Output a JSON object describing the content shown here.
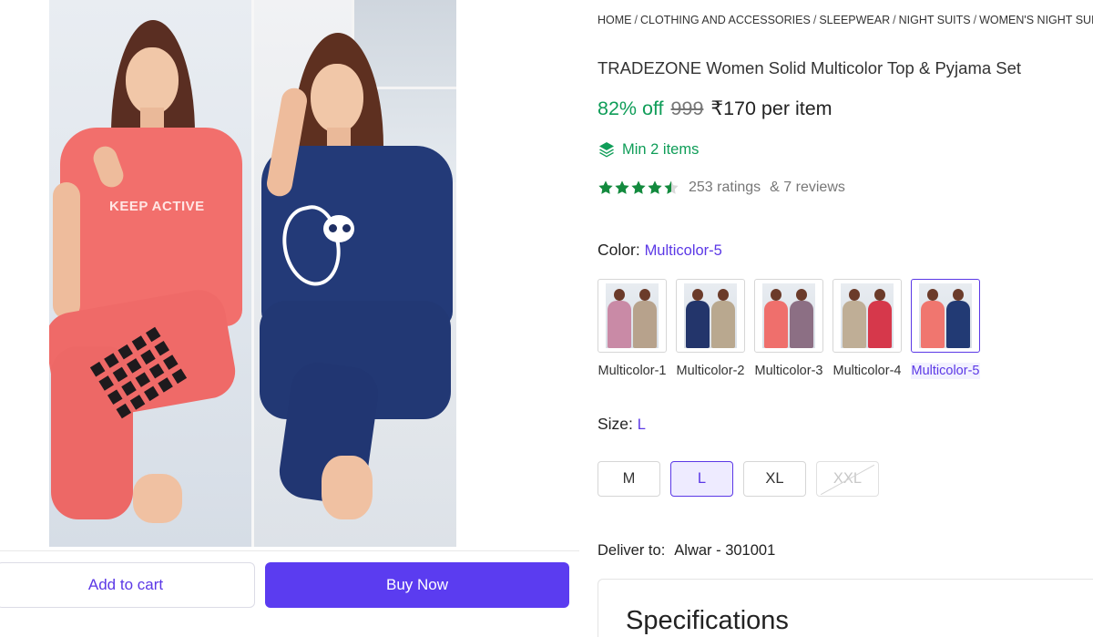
{
  "breadcrumb": [
    "HOME",
    "CLOTHING AND ACCESSORIES",
    "SLEEPWEAR",
    "NIGHT SUITS",
    "WOMEN'S NIGHT SUITS"
  ],
  "product": {
    "title": "TRADEZONE Women Solid Multicolor Top & Pyjama Set",
    "discount": "82% off",
    "mrp": "999",
    "price": "₹170 per item",
    "min_items": "Min 2 items",
    "rating_value": 4.5,
    "ratings": "253 ratings",
    "reviews": "& 7 reviews"
  },
  "image": {
    "shirt_text": "KEEP ACTIVE"
  },
  "color": {
    "label": "Color:",
    "selected": "Multicolor-5",
    "options": [
      {
        "label": "Multicolor-1",
        "left": "#c98aa6",
        "right": "#b7a28c"
      },
      {
        "label": "Multicolor-2",
        "left": "#23356b",
        "right": "#b9a88f"
      },
      {
        "label": "Multicolor-3",
        "left": "#ef6f6c",
        "right": "#8c6f84"
      },
      {
        "label": "Multicolor-4",
        "left": "#bfae96",
        "right": "#d6384b"
      },
      {
        "label": "Multicolor-5",
        "left": "#f0766f",
        "right": "#223a74"
      }
    ]
  },
  "size": {
    "label": "Size:",
    "selected": "L",
    "options": [
      "M",
      "L",
      "XL",
      "XXL"
    ]
  },
  "deliver": {
    "label": "Deliver to:",
    "location": "Alwar - 301001"
  },
  "actions": {
    "add_to_cart": "Add to cart",
    "buy_now": "Buy Now"
  },
  "specifications": {
    "title": "Specifications"
  },
  "colors": {
    "accent": "#5b38e6",
    "buy_button": "#5b3cf0",
    "green": "#0f9d58",
    "star": "#138a3e"
  }
}
